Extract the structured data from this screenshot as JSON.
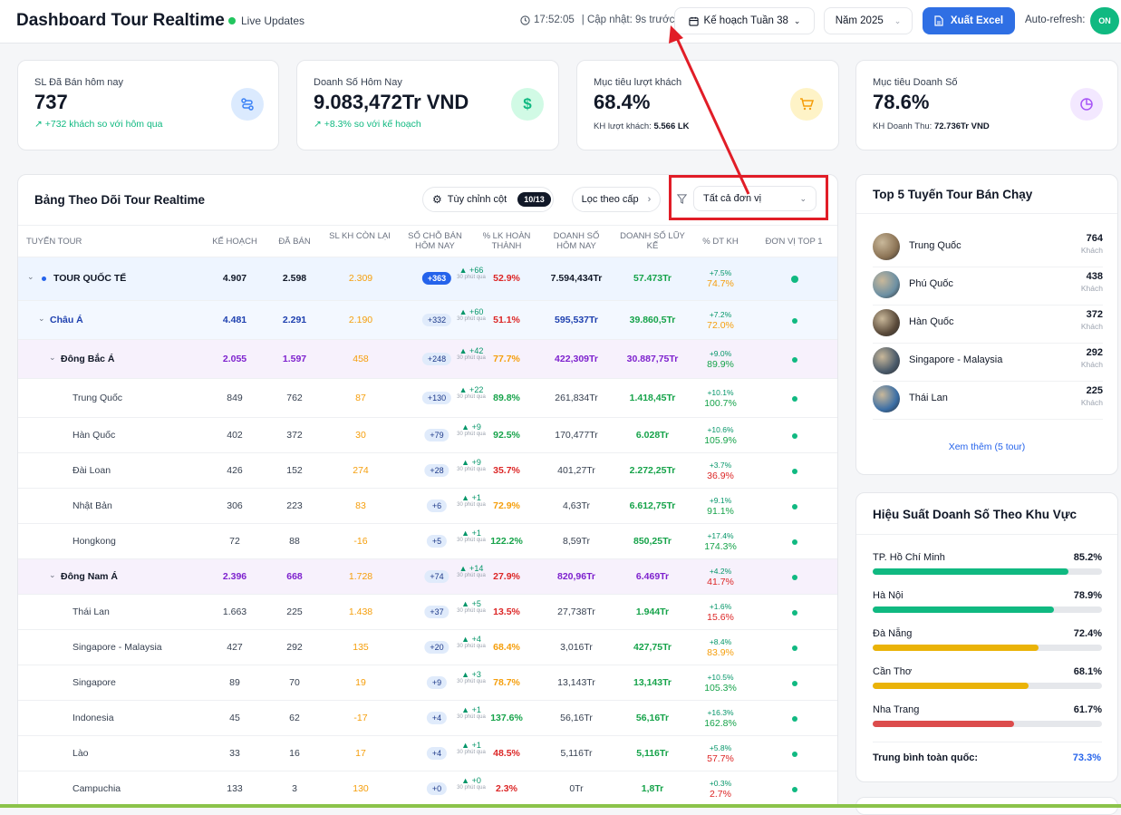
{
  "header": {
    "title": "Dashboard Tour Realtime",
    "live": "Live Updates",
    "time": "17:52:05",
    "updated": "| Cập nhật: 9s trước",
    "plan": "Kế hoạch Tuần 38",
    "year": "Năm 2025",
    "export": "Xuất Excel",
    "auto_refresh": "Auto-refresh:",
    "toggle": "ON"
  },
  "kpis": [
    {
      "label": "SL Đã Bán hôm nay",
      "value": "737",
      "sub": "+732 khách so với hôm qua",
      "icon": "route-icon",
      "color": "#dbeafe",
      "icon_color": "#3b82f6"
    },
    {
      "label": "Doanh Số Hôm Nay",
      "value": "9.083,472Tr VND",
      "sub": "+8.3% so với kế hoạch",
      "icon": "dollar-icon",
      "color": "#d1fae5",
      "icon_color": "#10b981"
    },
    {
      "label": "Mục tiêu lượt khách",
      "value": "68.4%",
      "sub_label": "KH lượt khách:",
      "sub_value": "5.566 LK",
      "icon": "cart-icon",
      "color": "#fef3c7",
      "icon_color": "#f59e0b"
    },
    {
      "label": "Mục tiêu Doanh Số",
      "value": "78.6%",
      "sub_label": "KH Doanh Thu:",
      "sub_value": "72.736Tr VND",
      "icon": "pie-icon",
      "color": "#f3e8ff",
      "icon_color": "#a855f7"
    }
  ],
  "table": {
    "title": "Bảng Theo Dõi Tour Realtime",
    "columns_btn": "Tùy chỉnh cột",
    "columns_count": "10/13",
    "level_btn": "Lọc theo cấp",
    "unit_filter": "Tất cả đơn vị",
    "headers": [
      "Tuyến Tour",
      "Kế Hoạch",
      "Đã Bán",
      "SL KH Còn Lại",
      "Số Chỗ Bán Hôm Nay",
      "% LK Hoàn Thành",
      "Doanh Số Hôm Nay",
      "Doanh Số Lũy Kế",
      "% DT KH",
      "Đơn Vị Top 1"
    ],
    "rows": [
      {
        "name": "TOUR QUỐC TẾ",
        "level": 0,
        "plan": "4.907",
        "sold": "2.598",
        "remain": "2.309",
        "today": "+363",
        "inc": "▲ +66",
        "inc_note": "30 phút qua",
        "pct": "52.9%",
        "rev": "7.594,434Tr",
        "cum": "57.473Tr",
        "dt_a": "+7.5%",
        "dt_b": "74.7%"
      },
      {
        "name": "Châu Á",
        "level": 1,
        "plan": "4.481",
        "sold": "2.291",
        "remain": "2.190",
        "today": "+332",
        "inc": "▲ +60",
        "inc_note": "30 phút qua",
        "pct": "51.1%",
        "rev": "595,537Tr",
        "cum": "39.860,5Tr",
        "dt_a": "+7.2%",
        "dt_b": "72.0%"
      },
      {
        "name": "Đông Bắc Á",
        "level": 2,
        "plan": "2.055",
        "sold": "1.597",
        "remain": "458",
        "today": "+248",
        "inc": "▲ +42",
        "inc_note": "30 phút qua",
        "pct": "77.7%",
        "rev": "422,309Tr",
        "cum": "30.887,75Tr",
        "dt_a": "+9.0%",
        "dt_b": "89.9%"
      },
      {
        "name": "Trung Quốc",
        "level": 3,
        "plan": "849",
        "sold": "762",
        "remain": "87",
        "today": "+130",
        "inc": "▲ +22",
        "inc_note": "30 phút qua",
        "pct": "89.8%",
        "rev": "261,834Tr",
        "cum": "1.418,45Tr",
        "dt_a": "+10.1%",
        "dt_b": "100.7%"
      },
      {
        "name": "Hàn Quốc",
        "level": 3,
        "plan": "402",
        "sold": "372",
        "remain": "30",
        "today": "+79",
        "inc": "▲ +9",
        "inc_note": "30 phút qua",
        "pct": "92.5%",
        "rev": "170,477Tr",
        "cum": "6.028Tr",
        "dt_a": "+10.6%",
        "dt_b": "105.9%"
      },
      {
        "name": "Đài Loan",
        "level": 3,
        "plan": "426",
        "sold": "152",
        "remain": "274",
        "today": "+28",
        "inc": "▲ +9",
        "inc_note": "30 phút qua",
        "pct": "35.7%",
        "rev": "401,27Tr",
        "cum": "2.272,25Tr",
        "dt_a": "+3.7%",
        "dt_b": "36.9%"
      },
      {
        "name": "Nhật Bản",
        "level": 3,
        "plan": "306",
        "sold": "223",
        "remain": "83",
        "today": "+6",
        "inc": "▲ +1",
        "inc_note": "30 phút qua",
        "pct": "72.9%",
        "rev": "4,63Tr",
        "cum": "6.612,75Tr",
        "dt_a": "+9.1%",
        "dt_b": "91.1%"
      },
      {
        "name": "Hongkong",
        "level": 3,
        "plan": "72",
        "sold": "88",
        "remain": "-16",
        "today": "+5",
        "inc": "▲ +1",
        "inc_note": "30 phút qua",
        "pct": "122.2%",
        "rev": "8,59Tr",
        "cum": "850,25Tr",
        "dt_a": "+17.4%",
        "dt_b": "174.3%"
      },
      {
        "name": "Đông Nam Á",
        "level": 2,
        "plan": "2.396",
        "sold": "668",
        "remain": "1.728",
        "today": "+74",
        "inc": "▲ +14",
        "inc_note": "30 phút qua",
        "pct": "27.9%",
        "rev": "820,96Tr",
        "cum": "6.469Tr",
        "dt_a": "+4.2%",
        "dt_b": "41.7%"
      },
      {
        "name": "Thái Lan",
        "level": 3,
        "plan": "1.663",
        "sold": "225",
        "remain": "1.438",
        "today": "+37",
        "inc": "▲ +5",
        "inc_note": "30 phút qua",
        "pct": "13.5%",
        "rev": "27,738Tr",
        "cum": "1.944Tr",
        "dt_a": "+1.6%",
        "dt_b": "15.6%"
      },
      {
        "name": "Singapore - Malaysia",
        "level": 3,
        "plan": "427",
        "sold": "292",
        "remain": "135",
        "today": "+20",
        "inc": "▲ +4",
        "inc_note": "30 phút qua",
        "pct": "68.4%",
        "rev": "3,016Tr",
        "cum": "427,75Tr",
        "dt_a": "+8.4%",
        "dt_b": "83.9%"
      },
      {
        "name": "Singapore",
        "level": 3,
        "plan": "89",
        "sold": "70",
        "remain": "19",
        "today": "+9",
        "inc": "▲ +3",
        "inc_note": "30 phút qua",
        "pct": "78.7%",
        "rev": "13,143Tr",
        "cum": "13,143Tr",
        "dt_a": "+10.5%",
        "dt_b": "105.3%"
      },
      {
        "name": "Indonesia",
        "level": 3,
        "plan": "45",
        "sold": "62",
        "remain": "-17",
        "today": "+4",
        "inc": "▲ +1",
        "inc_note": "30 phút qua",
        "pct": "137.6%",
        "rev": "56,16Tr",
        "cum": "56,16Tr",
        "dt_a": "+16.3%",
        "dt_b": "162.8%"
      },
      {
        "name": "Lào",
        "level": 3,
        "plan": "33",
        "sold": "16",
        "remain": "17",
        "today": "+4",
        "inc": "▲ +1",
        "inc_note": "30 phút qua",
        "pct": "48.5%",
        "rev": "5,116Tr",
        "cum": "5,116Tr",
        "dt_a": "+5.8%",
        "dt_b": "57.7%"
      },
      {
        "name": "Campuchia",
        "level": 3,
        "plan": "133",
        "sold": "3",
        "remain": "130",
        "today": "+0",
        "inc": "▲ +0",
        "inc_note": "30 phút qua",
        "pct": "2.3%",
        "rev": "0Tr",
        "cum": "1,8Tr",
        "dt_a": "+0.3%",
        "dt_b": "2.7%"
      }
    ]
  },
  "top5": {
    "title": "Top 5 Tuyến Tour Bán Chạy",
    "unit": "Khách",
    "items": [
      {
        "name": "Trung Quốc",
        "value": "764",
        "color": "#8b7355"
      },
      {
        "name": "Phú Quốc",
        "value": "438",
        "color": "#6b8fa3"
      },
      {
        "name": "Hàn Quốc",
        "value": "372",
        "color": "#5a4a3a"
      },
      {
        "name": "Singapore - Malaysia",
        "value": "292",
        "color": "#4a5a6a"
      },
      {
        "name": "Thái Lan",
        "value": "225",
        "color": "#3b6ea5"
      }
    ],
    "more": "Xem thêm (5 tour)"
  },
  "regions": {
    "title": "Hiệu Suất Doanh Số Theo Khu Vực",
    "items": [
      {
        "name": "TP. Hồ Chí Minh",
        "value": "85.2%",
        "pct": 85.2,
        "color": "#10b981"
      },
      {
        "name": "Hà Nội",
        "value": "78.9%",
        "pct": 78.9,
        "color": "#10b981"
      },
      {
        "name": "Đà Nẵng",
        "value": "72.4%",
        "pct": 72.4,
        "color": "#eab308"
      },
      {
        "name": "Cần Thơ",
        "value": "68.1%",
        "pct": 68.1,
        "color": "#eab308"
      },
      {
        "name": "Nha Trang",
        "value": "61.7%",
        "pct": 61.7,
        "color": "#dc4c4c"
      }
    ],
    "avg_label": "Trung bình toàn quốc:",
    "avg_value": "73.3%"
  }
}
